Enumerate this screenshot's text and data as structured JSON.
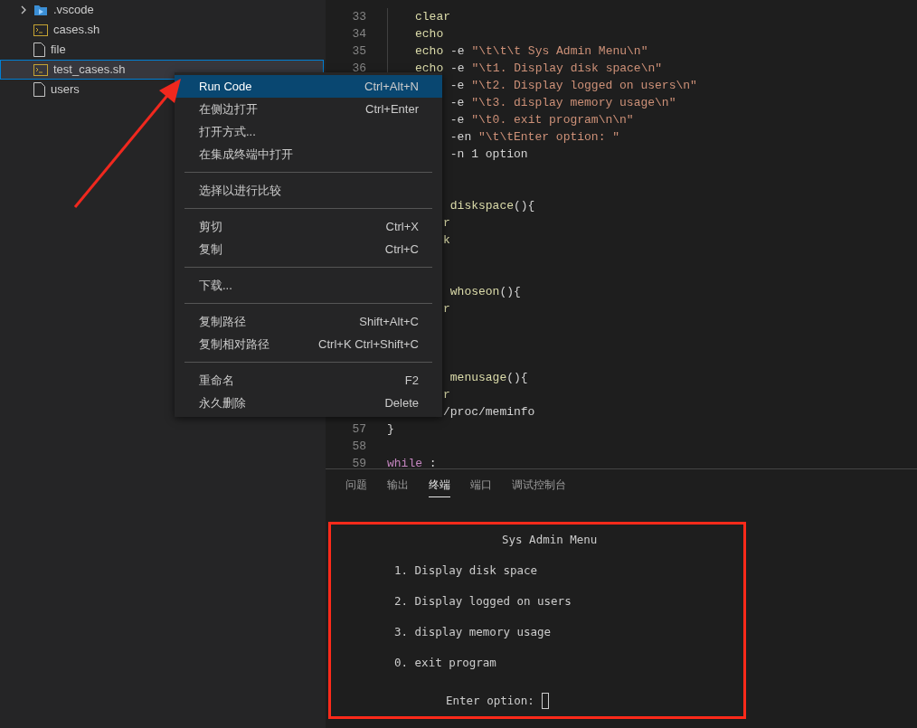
{
  "explorer": {
    "items": [
      {
        "name": ".vscode",
        "kind": "folder",
        "expanded": false,
        "selected": false
      },
      {
        "name": "cases.sh",
        "kind": "shell",
        "selected": false
      },
      {
        "name": "file",
        "kind": "file",
        "selected": false
      },
      {
        "name": "test_cases.sh",
        "kind": "shell",
        "selected": true
      },
      {
        "name": "users",
        "kind": "file",
        "selected": false
      }
    ]
  },
  "editor": {
    "lines": [
      {
        "number": "33",
        "indented": true,
        "tokens": [
          {
            "kind": "fn",
            "text": "clear"
          }
        ]
      },
      {
        "number": "34",
        "indented": true,
        "tokens": [
          {
            "kind": "fn",
            "text": "echo"
          }
        ]
      },
      {
        "number": "35",
        "indented": true,
        "tokens": [
          {
            "kind": "fn",
            "text": "echo"
          },
          {
            "kind": "plain",
            "text": " -e "
          },
          {
            "kind": "string",
            "text": "\"\\t\\t\\t Sys Admin Menu\\n\""
          }
        ]
      },
      {
        "number": "36",
        "indented": true,
        "tokens": [
          {
            "kind": "fn",
            "text": "echo"
          },
          {
            "kind": "plain",
            "text": " -e "
          },
          {
            "kind": "string",
            "text": "\"\\t1. Display disk space\\n\""
          }
        ]
      },
      {
        "tokens": [
          {
            "kind": "plain",
            "text": " -e "
          },
          {
            "kind": "string",
            "text": "\"\\t2. Display logged on users\\n\""
          }
        ]
      },
      {
        "tokens": [
          {
            "kind": "plain",
            "text": " -e "
          },
          {
            "kind": "string",
            "text": "\"\\t3. display memory usage\\n\""
          }
        ]
      },
      {
        "tokens": [
          {
            "kind": "plain",
            "text": " -e "
          },
          {
            "kind": "string",
            "text": "\"\\t0. exit program\\n\\n\""
          }
        ]
      },
      {
        "tokens": [
          {
            "kind": "plain",
            "text": " -en "
          },
          {
            "kind": "string",
            "text": "\"\\t\\tEnter option: \""
          }
        ]
      },
      {
        "tokens": [
          {
            "kind": "plain",
            "text": " -n 1 option"
          }
        ]
      },
      {
        "kind": "blank"
      },
      {
        "kind": "blank"
      },
      {
        "tokens": [
          {
            "kind": "fn",
            "text": " diskspace"
          },
          {
            "kind": "plain",
            "text": "(){"
          }
        ]
      },
      {
        "tokens": [
          {
            "kind": "fn",
            "text": "r"
          }
        ]
      },
      {
        "tokens": [
          {
            "kind": "fn",
            "text": "k"
          }
        ]
      },
      {
        "kind": "blank"
      },
      {
        "kind": "blank"
      },
      {
        "tokens": [
          {
            "kind": "fn",
            "text": " whoseon"
          },
          {
            "kind": "plain",
            "text": "(){"
          }
        ]
      },
      {
        "tokens": [
          {
            "kind": "fn",
            "text": "r"
          }
        ]
      },
      {
        "kind": "blank"
      },
      {
        "kind": "blank"
      },
      {
        "kind": "blank"
      },
      {
        "tokens": [
          {
            "kind": "fn",
            "text": " menusage"
          },
          {
            "kind": "plain",
            "text": "(){"
          }
        ]
      },
      {
        "tokens": [
          {
            "kind": "fn",
            "text": "r"
          }
        ]
      },
      {
        "tokens": [
          {
            "kind": "plain",
            "text": "/proc/meminfo"
          }
        ]
      },
      {
        "number": "57",
        "tokens": [
          {
            "kind": "plain",
            "text": "}"
          }
        ]
      },
      {
        "number": "58"
      },
      {
        "number": "59",
        "tokens": [
          {
            "kind": "control",
            "text": "while"
          },
          {
            "kind": "plain",
            "text": " :"
          }
        ]
      }
    ]
  },
  "context_menu": {
    "groups": [
      [
        {
          "label": "Run Code",
          "shortcut": "Ctrl+Alt+N",
          "selected": true
        },
        {
          "label": "在侧边打开",
          "shortcut": "Ctrl+Enter",
          "selected": false
        },
        {
          "label": "打开方式...",
          "selected": false
        },
        {
          "label": "在集成终端中打开",
          "selected": false
        }
      ],
      [
        {
          "label": "选择以进行比较",
          "selected": false
        }
      ],
      [
        {
          "label": "剪切",
          "shortcut": "Ctrl+X",
          "selected": false
        },
        {
          "label": "复制",
          "shortcut": "Ctrl+C",
          "selected": false
        }
      ],
      [
        {
          "label": "下载...",
          "selected": false
        }
      ],
      [
        {
          "label": "复制路径",
          "shortcut": "Shift+Alt+C",
          "selected": false
        },
        {
          "label": "复制相对路径",
          "shortcut": "Ctrl+K Ctrl+Shift+C",
          "selected": false
        }
      ],
      [
        {
          "label": "重命名",
          "shortcut": "F2",
          "selected": false
        },
        {
          "label": "永久删除",
          "shortcut": "Delete",
          "selected": false
        }
      ]
    ]
  },
  "panel": {
    "tabs": [
      {
        "label": "问题",
        "selected": false
      },
      {
        "label": "输出",
        "selected": false
      },
      {
        "label": "终端",
        "selected": true
      },
      {
        "label": "端口",
        "selected": false
      },
      {
        "label": "调试控制台",
        "selected": false
      }
    ],
    "terminal": {
      "lines": [
        {
          "kind": "title",
          "text": "Sys Admin Menu"
        },
        {
          "kind": "item",
          "text": "1. Display disk space"
        },
        {
          "kind": "item",
          "text": "2. Display logged on users"
        },
        {
          "kind": "item",
          "text": "3. display memory usage"
        },
        {
          "kind": "item",
          "text": "0. exit program"
        },
        {
          "kind": "prompt",
          "text": "Enter option:"
        }
      ]
    }
  }
}
